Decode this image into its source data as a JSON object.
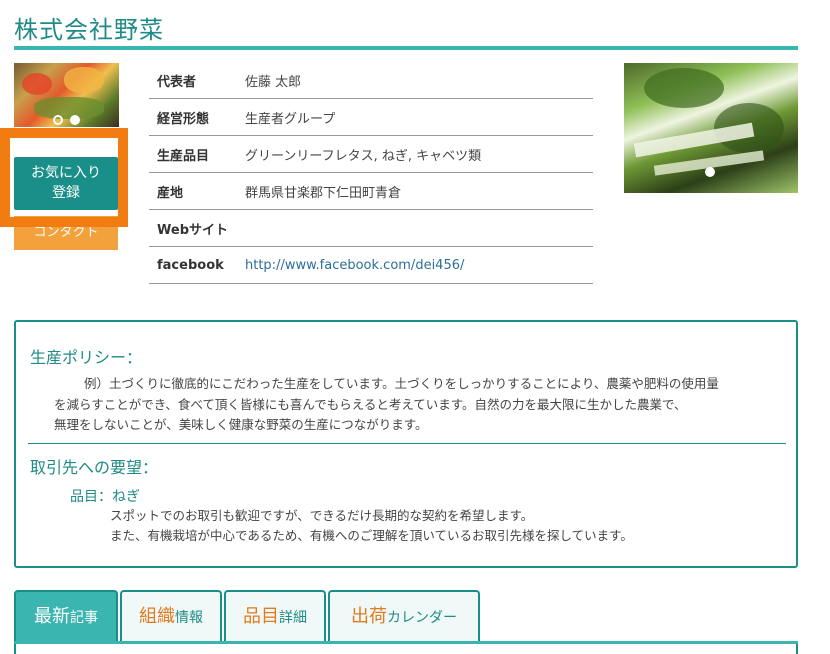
{
  "page": {
    "title": "株式会社野菜"
  },
  "buttons": {
    "favorite": "お気に入り登録",
    "contact": "コンタクト"
  },
  "profile": [
    {
      "label": "代表者",
      "value": "佐藤 太郎"
    },
    {
      "label": "経営形態",
      "value": "生産者グループ"
    },
    {
      "label": "生産品目",
      "value": "グリーンリーフレタス, ねぎ, キャベツ類"
    },
    {
      "label": "産地",
      "value": "群馬県甘楽郡下仁田町青倉"
    },
    {
      "label": "Webサイト",
      "value": ""
    },
    {
      "label": "facebook",
      "value": "http://www.facebook.com/dei456/"
    }
  ],
  "policy": {
    "heading": "生産ポリシー：",
    "lines": [
      "例）土づくりに徹底的にこだわった生産をしています。土づくりをしっかりすることにより、農薬や肥料の使用量",
      "を減らすことができ、食べて頂く皆様にも喜んでもらえると考えています。自然の力を最大限に生かした農業で、",
      "無理をしないことが、美味しく健康な野菜の生産につながります。"
    ]
  },
  "request": {
    "heading": "取引先への要望：",
    "item": "品目：ねぎ",
    "lines": [
      "スポットでのお取引も歓迎ですが、できるだけ長期的な契約を希望します。",
      "また、有機栽培が中心であるため、有機へのご理解を頂いているお取引先様を探しています。"
    ]
  },
  "tabs": [
    {
      "big": "最新",
      "small": "記事"
    },
    {
      "big": "組織",
      "small": "情報"
    },
    {
      "big": "品目",
      "small": "詳細"
    },
    {
      "big": "出荷",
      "small": "カレンダー"
    }
  ],
  "colors": {
    "accent": "#1a8f8a",
    "tab_active": "#3bb5b0",
    "orange": "#e07b1e",
    "highlight": "#f07c12"
  }
}
